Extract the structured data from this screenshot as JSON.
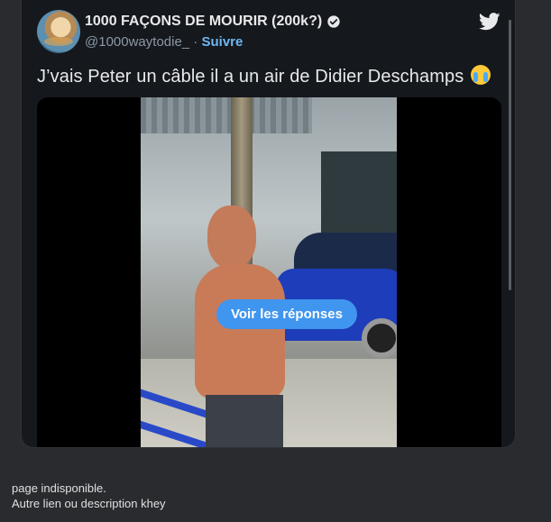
{
  "tweet": {
    "display_name": "1000 FAÇONS DE MOURIR (200k?)",
    "handle": "@1000waytodie_",
    "separator": " · ",
    "follow_label": "Suivre",
    "text": "J’vais Peter un câble il a un air de Didier Deschamps",
    "emoji": "loudly-crying-face-emoji",
    "replies_button": "Voir les réponses"
  },
  "footer": {
    "line1": "page indisponible.",
    "line2": "Autre lien ou description khey"
  },
  "colors": {
    "page_bg": "#2a2b2f",
    "card_bg": "#15181c",
    "accent": "#4096ef",
    "link": "#6cb8f5"
  }
}
